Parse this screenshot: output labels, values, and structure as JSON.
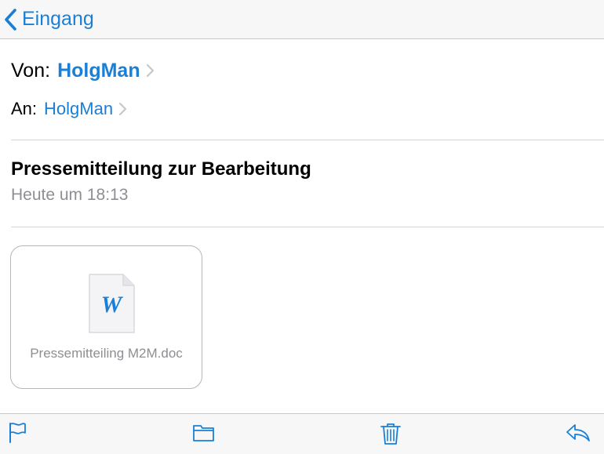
{
  "navbar": {
    "back_label": "Eingang"
  },
  "message": {
    "from_label": "Von:",
    "from_name": "HolgMan",
    "to_label": "An:",
    "to_name": "HolgMan",
    "subject": "Pressemitteilung zur Bearbeitung",
    "timestamp": "Heute um 18:13"
  },
  "attachment": {
    "filename": "Pressemitteiling M2M.doc",
    "icon_letter": "W",
    "icon": "word-document-icon"
  },
  "toolbar": {
    "icons": [
      "flag-icon",
      "folder-icon",
      "trash-icon",
      "reply-icon"
    ]
  },
  "colors": {
    "accent": "#1a7fd6",
    "secondary_text": "#8e8e93",
    "bar_background": "#f7f7f8"
  }
}
